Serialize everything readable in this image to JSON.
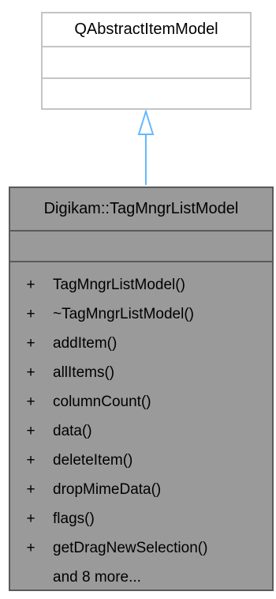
{
  "base_class": {
    "name": "QAbstractItemModel"
  },
  "derived_class": {
    "name": "Digikam::TagMngrListModel",
    "operations": [
      {
        "visibility": "+",
        "name": "TagMngrListModel()"
      },
      {
        "visibility": "+",
        "name": "~TagMngrListModel()"
      },
      {
        "visibility": "+",
        "name": "addItem()"
      },
      {
        "visibility": "+",
        "name": "allItems()"
      },
      {
        "visibility": "+",
        "name": "columnCount()"
      },
      {
        "visibility": "+",
        "name": "data()"
      },
      {
        "visibility": "+",
        "name": "deleteItem()"
      },
      {
        "visibility": "+",
        "name": "dropMimeData()"
      },
      {
        "visibility": "+",
        "name": "flags()"
      },
      {
        "visibility": "+",
        "name": "getDragNewSelection()"
      },
      {
        "visibility": "",
        "name": "and 8 more..."
      }
    ]
  },
  "colors": {
    "arrow": "#63b8ff",
    "base_border": "#c4c4c4",
    "derived_fill": "#9a9a9a",
    "derived_border": "#5a5a5a"
  }
}
